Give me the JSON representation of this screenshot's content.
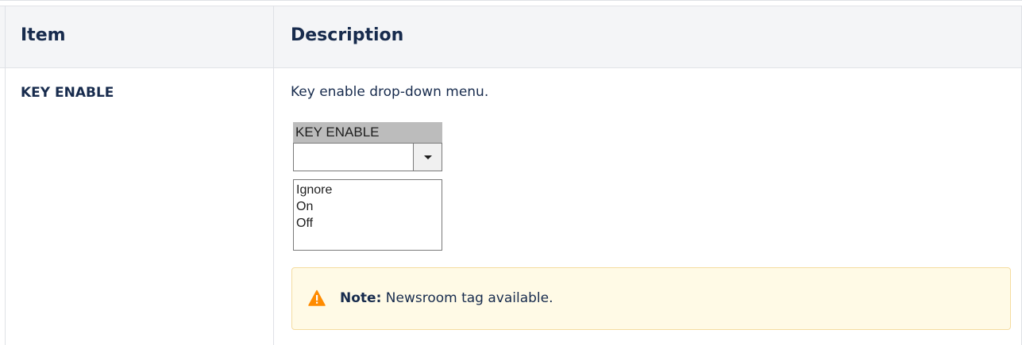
{
  "table": {
    "headers": [
      "Item",
      "Description"
    ],
    "rows": [
      {
        "item": "KEY ENABLE",
        "description": "Key enable drop-down menu.",
        "dropdown": {
          "caption": "KEY ENABLE",
          "selected_value": "",
          "options": [
            "Ignore",
            "On",
            "Off"
          ]
        },
        "note": {
          "label": "Note:",
          "text": " Newsroom tag available.",
          "icon": "warning-icon",
          "color": "#ff8b00"
        }
      }
    ]
  }
}
